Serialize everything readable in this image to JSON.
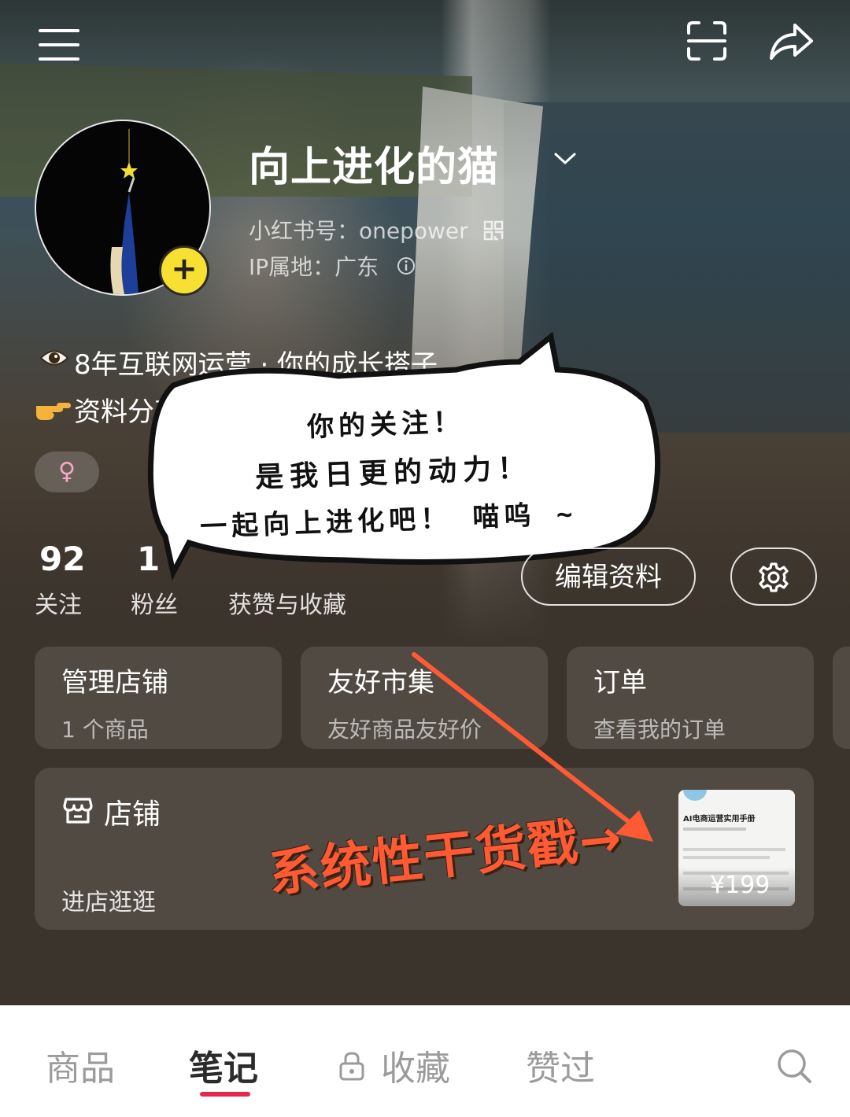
{
  "header": {
    "menu_icon": "hamburger-menu-icon",
    "scan_icon": "scan-icon",
    "share_icon": "share-icon"
  },
  "profile": {
    "name": "向上进化的猫",
    "id_label": "小红书号：onepower",
    "ip_label": "IP属地：广东",
    "add_icon": "plus-icon",
    "bio_line1": "8年互联网运营 · 你的成长搭子",
    "bio_line2": "资料分享",
    "gender_symbol": "♀"
  },
  "stats": {
    "following_count": "92",
    "following_label": "关注",
    "followers_count": "1",
    "followers_label": "粉丝",
    "likes_label": "获赞与收藏"
  },
  "actions": {
    "edit_profile": "编辑资料",
    "settings_icon": "gear-icon"
  },
  "bubble": {
    "line1": "你的关注！",
    "line2": "是我日更的动力！",
    "line3": "一起向上进化吧！ 喵呜 ~"
  },
  "cards": [
    {
      "title": "管理店铺",
      "subtitle": "1 个商品"
    },
    {
      "title": "友好市集",
      "subtitle": "友好商品友好价"
    },
    {
      "title": "订单",
      "subtitle": "查看我的订单"
    }
  ],
  "shop": {
    "title": "店铺",
    "enter": "进店逛逛",
    "promo": "系统性干货戳→",
    "product_title": "AI电商运营实用手册",
    "product_price": "¥199"
  },
  "tabs": {
    "goods": "商品",
    "notes": "笔记",
    "favorites": "收藏",
    "liked": "赞过",
    "active": "笔记"
  },
  "colors": {
    "accent": "#e8274c",
    "promo": "#ff5a34",
    "add_button": "#f7e032"
  }
}
